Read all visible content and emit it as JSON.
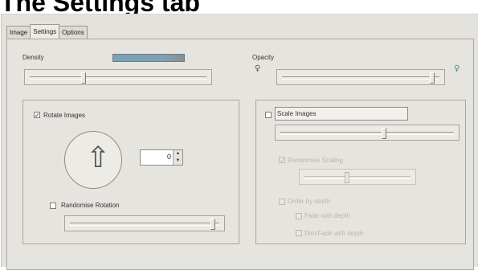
{
  "heading": "The Settings tab",
  "tabs": [
    "Image",
    "Settings",
    "Options"
  ],
  "density": {
    "label": "Density",
    "slider_value": 0.3
  },
  "opacity": {
    "label": "Opacity",
    "slider_value": 0.97
  },
  "rotate": {
    "checkbox_label": "Rotate Images",
    "checked": true,
    "angle": "0",
    "randomise_label": "Randomise Rotation",
    "randomise_checked": false,
    "slider_value": 0.97
  },
  "scale": {
    "checkbox_label": "Scale Images",
    "checked": false,
    "slider_value": 0.6,
    "randomise_label": "Randomise Scaling",
    "randomise_checked": true,
    "randomise_slider_value": 0.4,
    "order_label": "Order by depth",
    "fade_label": "Fade with depth",
    "dim_label": "Dim/Fade with depth"
  },
  "check_mark": "✓",
  "icons": {
    "spin_up": "▲",
    "spin_down": "▼",
    "arrow": "⇧",
    "bulb": "♀"
  }
}
